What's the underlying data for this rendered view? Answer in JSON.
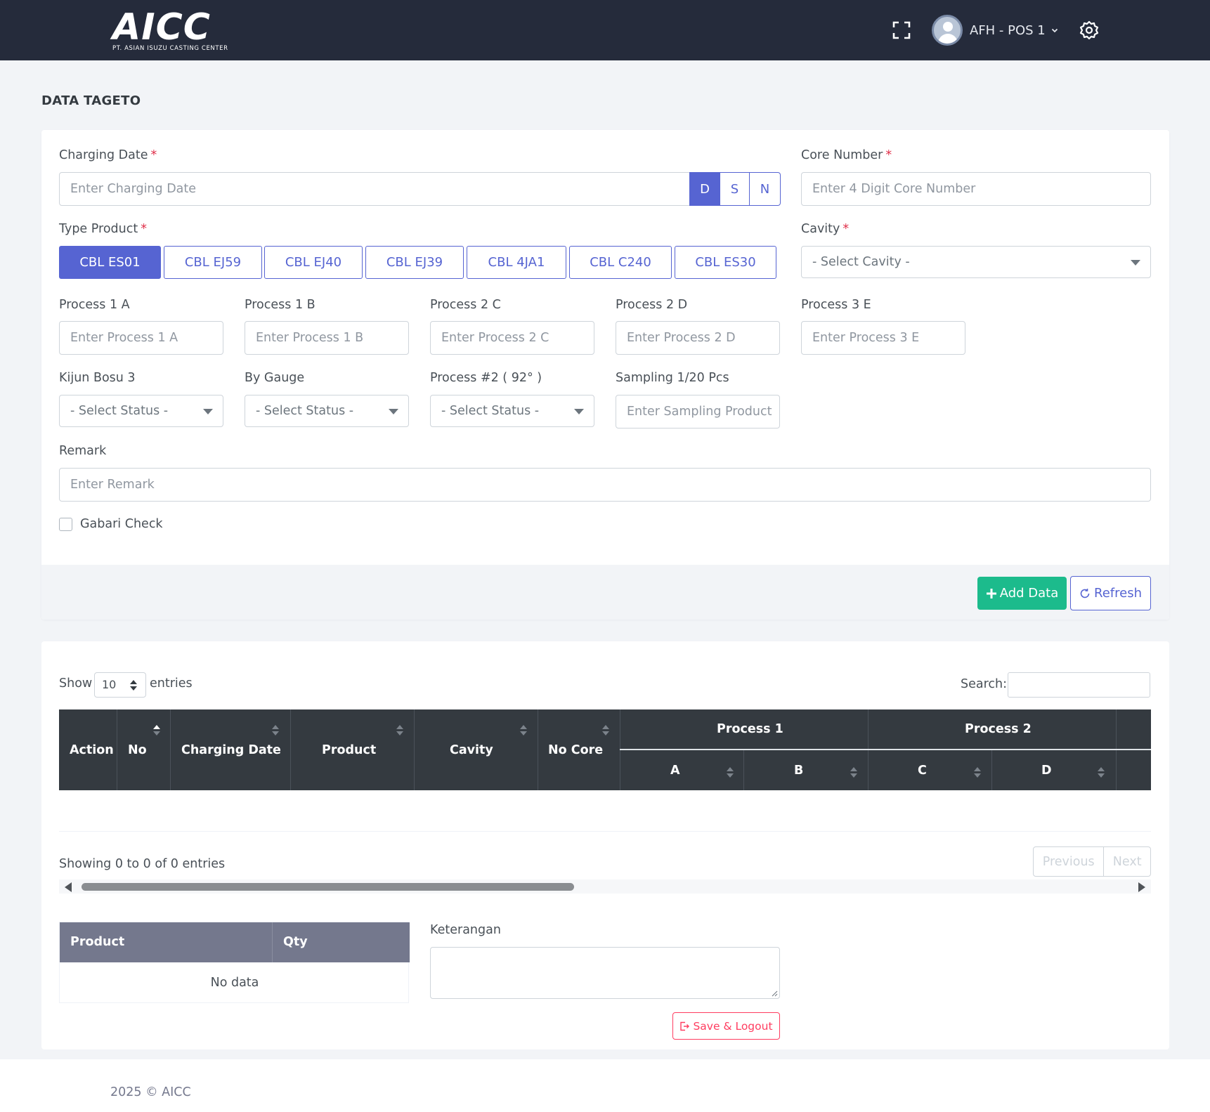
{
  "header": {
    "logo_text": "AICC",
    "logo_subtext": "PT. ASIAN ISUZU CASTING CENTER",
    "user_name": "AFH - POS 1",
    "colors": {
      "topbar": "#252b3b",
      "primary": "#5664d2",
      "success": "#1cbb8c",
      "danger": "#ff3d60"
    }
  },
  "page": {
    "title": "DATA TAGETO"
  },
  "form": {
    "charging_date": {
      "label": "Charging Date",
      "required": "*",
      "placeholder": "Enter Charging Date"
    },
    "shifts": [
      {
        "label": "D",
        "active": true
      },
      {
        "label": "S",
        "active": false
      },
      {
        "label": "N",
        "active": false
      }
    ],
    "core_number": {
      "label": "Core Number",
      "required": "*",
      "placeholder": "Enter 4 Digit Core Number"
    },
    "type_product": {
      "label": "Type Product",
      "required": "*",
      "options": [
        "CBL ES01",
        "CBL EJ59",
        "CBL EJ40",
        "CBL EJ39",
        "CBL 4JA1",
        "CBL C240",
        "CBL ES30"
      ],
      "selected": "CBL ES01"
    },
    "cavity": {
      "label": "Cavity",
      "required": "*",
      "value": "- Select Cavity -"
    },
    "process_1a": {
      "label": "Process 1 A",
      "placeholder": "Enter Process 1 A"
    },
    "process_1b": {
      "label": "Process 1 B",
      "placeholder": "Enter Process 1 B"
    },
    "process_2c": {
      "label": "Process 2 C",
      "placeholder": "Enter Process 2 C"
    },
    "process_2d": {
      "label": "Process 2 D",
      "placeholder": "Enter Process 2 D"
    },
    "process_3e": {
      "label": "Process 3 E",
      "placeholder": "Enter Process 3 E"
    },
    "kijun_bosu": {
      "label": "Kijun Bosu 3",
      "value": "- Select Status -"
    },
    "by_gauge": {
      "label": "By Gauge",
      "value": "- Select Status -"
    },
    "process_92": {
      "label": "Process #2 ( 92° )",
      "value": "- Select Status -"
    },
    "sampling": {
      "label": "Sampling 1/20 Pcs",
      "placeholder": "Enter Sampling Product"
    },
    "remark": {
      "label": "Remark",
      "placeholder": "Enter Remark"
    },
    "gabari": {
      "label": "Gabari Check",
      "checked": false
    },
    "add_button": "Add Data",
    "refresh_button": "Refresh"
  },
  "table": {
    "show_label": "Show",
    "page_length": "10",
    "entries_label": "entries",
    "search_label": "Search:",
    "columns": [
      "Action",
      "No",
      "Charging Date",
      "Product",
      "Cavity",
      "No Core"
    ],
    "group_columns": [
      {
        "label": "Process 1",
        "subs": [
          "A",
          "B"
        ]
      },
      {
        "label": "Process 2",
        "subs": [
          "C",
          "D"
        ]
      }
    ],
    "info": "Showing 0 to 0 of 0 entries",
    "pagination": {
      "previous": "Previous",
      "next": "Next"
    }
  },
  "summary": {
    "columns": [
      "Product",
      "Qty"
    ],
    "empty_text": "No data",
    "keterangan_label": "Keterangan",
    "save_logout_button": "Save & Logout"
  },
  "footer": {
    "text": "2025 © AICC"
  }
}
